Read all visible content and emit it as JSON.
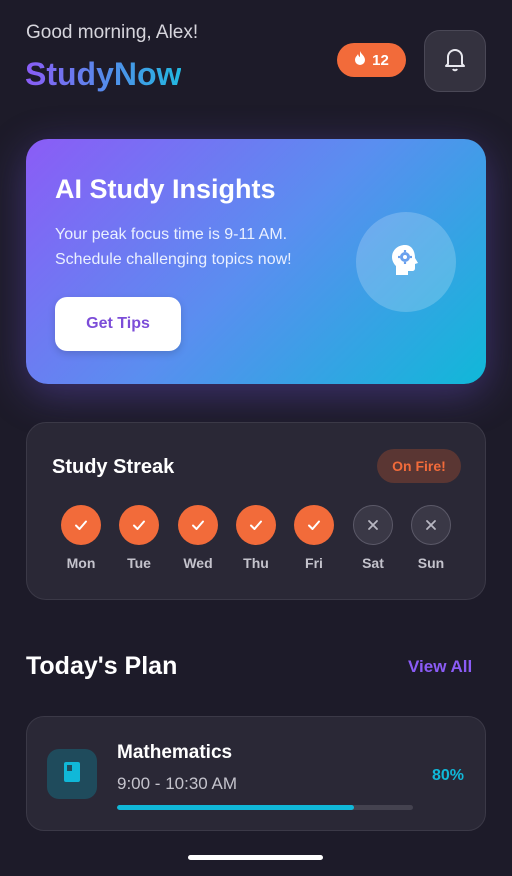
{
  "header": {
    "greeting": "Good morning, Alex!",
    "brand": "StudyNow",
    "streak_count": "12",
    "streak_icon": "fire-icon",
    "notifications_icon": "bell-icon"
  },
  "insights": {
    "title": "AI Study Insights",
    "text": "Your peak focus time is 9-11 AM. Schedule challenging topics now!",
    "button_label": "Get Tips",
    "icon": "brain-gear-icon"
  },
  "streak": {
    "title": "Study Streak",
    "badge": "On Fire!",
    "days": [
      {
        "label": "Mon",
        "done": true
      },
      {
        "label": "Tue",
        "done": true
      },
      {
        "label": "Wed",
        "done": true
      },
      {
        "label": "Thu",
        "done": true
      },
      {
        "label": "Fri",
        "done": true
      },
      {
        "label": "Sat",
        "done": false
      },
      {
        "label": "Sun",
        "done": false
      }
    ]
  },
  "plan": {
    "title": "Today's Plan",
    "view_all": "View All",
    "items": [
      {
        "subject": "Mathematics",
        "time": "9:00 - 10:30 AM",
        "progress_label": "80%",
        "progress": 0.8,
        "icon": "book-icon"
      }
    ]
  },
  "colors": {
    "background": "#1d1b29",
    "accent_purple": "#8b5cf6",
    "accent_cyan": "#10b8d8",
    "streak_orange": "#f26b3a"
  }
}
